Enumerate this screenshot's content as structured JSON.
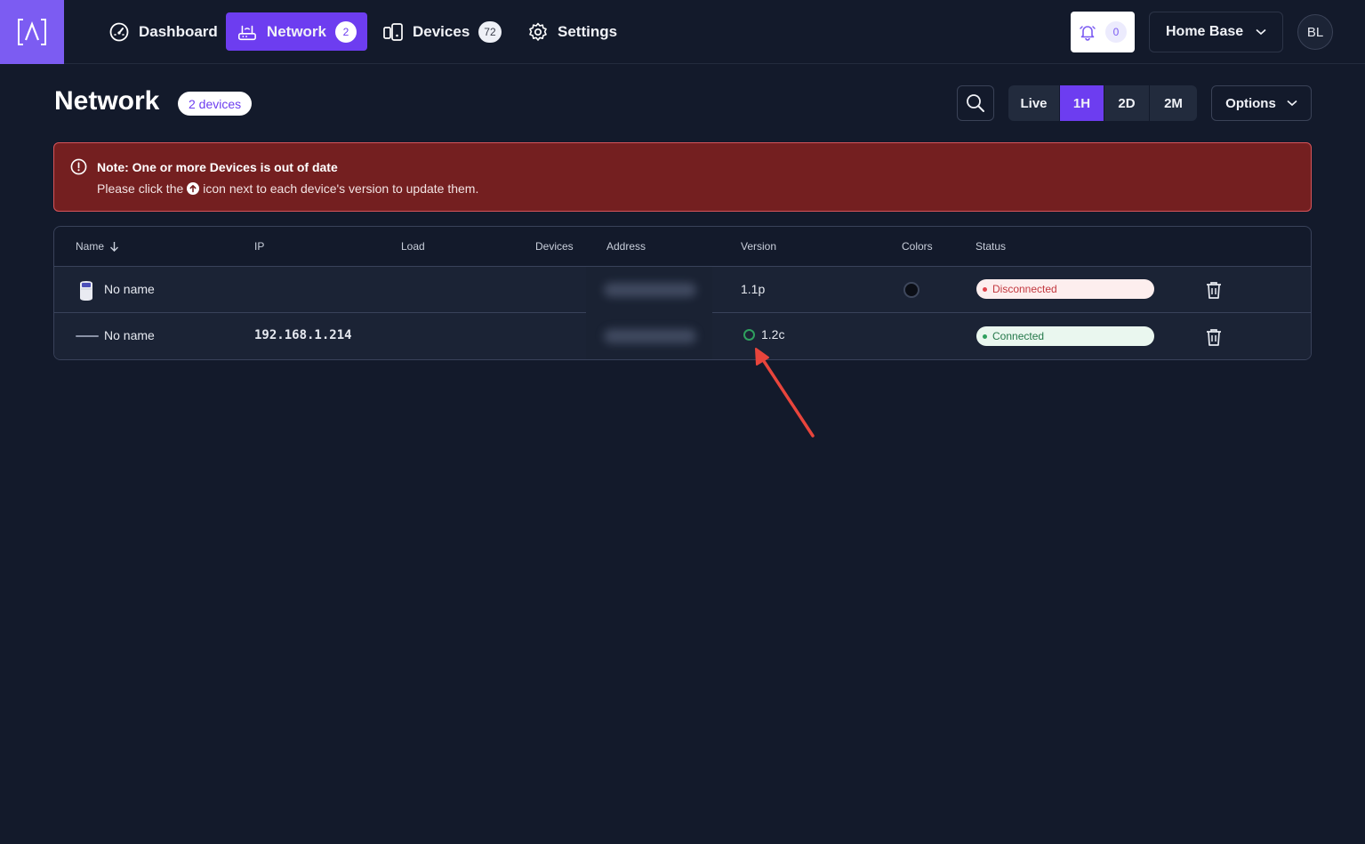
{
  "nav": {
    "items": [
      {
        "label": "Dashboard",
        "icon": "gauge-icon"
      },
      {
        "label": "Network",
        "icon": "router-icon",
        "badge": "2",
        "active": true
      },
      {
        "label": "Devices",
        "icon": "devices-icon",
        "badge": "72"
      },
      {
        "label": "Settings",
        "icon": "gear-icon"
      }
    ],
    "notifications": "0",
    "site": "Home Base",
    "avatar": "BL"
  },
  "header": {
    "title": "Network",
    "count": "2 devices",
    "ranges": [
      "Live",
      "1H",
      "2D",
      "2M"
    ],
    "active_range": "1H",
    "options": "Options"
  },
  "alert": {
    "title": "Note: One or more Devices is out of date",
    "body_before": "Please click the",
    "body_after": "icon next to each device's version to update them."
  },
  "table": {
    "columns": [
      "Name",
      "IP",
      "Load",
      "Devices",
      "Address",
      "Version",
      "Colors",
      "Status"
    ],
    "rows": [
      {
        "name": "No name",
        "ip": "",
        "version": "1.1p",
        "status": "Disconnected"
      },
      {
        "name": "No name",
        "ip": "192.168.1.214",
        "version": "1.2c",
        "status": "Connected"
      }
    ]
  },
  "colors": {
    "accent": "#6d3df0",
    "brand": "#7c5cf2",
    "alert_bg": "#741f20",
    "connected": "#2fa05e",
    "disconnected": "#e0434b"
  }
}
